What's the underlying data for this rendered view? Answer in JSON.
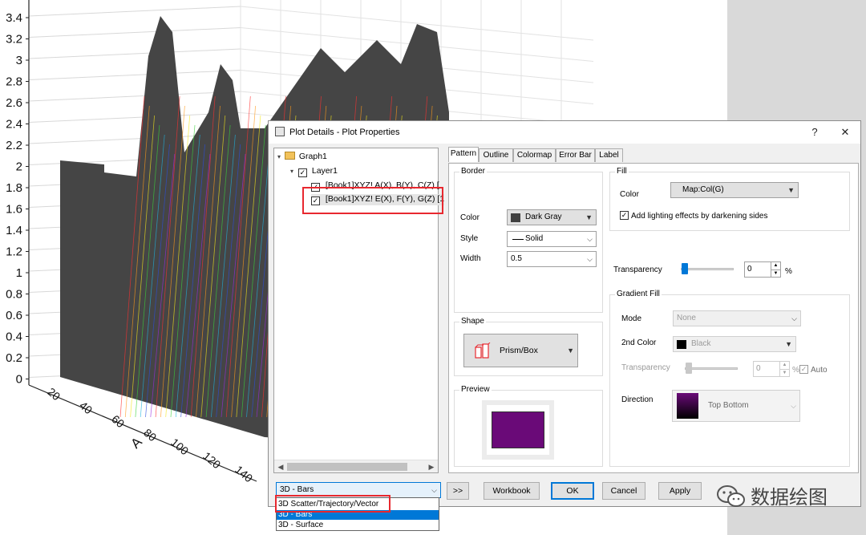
{
  "background_graph": {
    "y_ticks": [
      "3.4",
      "3.2",
      "3",
      "2.8",
      "2.6",
      "2.4",
      "2.2",
      "2",
      "1.8",
      "1.6",
      "1.4",
      "1.2",
      "1",
      "0.8",
      "0.6",
      "0.4",
      "0.2",
      "0"
    ],
    "x_ticks": [
      "20",
      "40",
      "60",
      "80",
      "100",
      "120",
      "140"
    ],
    "x_axis_label": "A"
  },
  "dialog": {
    "title": "Plot Details - Plot Properties",
    "help_button": "?",
    "close_button": "✕",
    "tree": {
      "root": "Graph1",
      "layer": "Layer1",
      "plots": [
        "[Book1]XYZ! A(X), B(Y), C(Z) [",
        "[Book1]XYZ! E(X), F(Y), G(Z) [1"
      ]
    },
    "tabs": [
      "Pattern",
      "Outline",
      "Colormap",
      "Error Bar",
      "Label"
    ],
    "border": {
      "group_label": "Border",
      "color_label": "Color",
      "color_value": "Dark Gray",
      "style_label": "Style",
      "style_value": "Solid",
      "width_label": "Width",
      "width_value": "0.5"
    },
    "fill": {
      "group_label": "Fill",
      "color_label": "Color",
      "color_value": "Map:Col(G)",
      "lighting_label": "Add lighting effects by darkening sides",
      "lighting_checked": true
    },
    "transparency": {
      "label": "Transparency",
      "value": "0",
      "unit": "%",
      "level": 0
    },
    "gradient": {
      "group_label": "Gradient Fill",
      "mode_label": "Mode",
      "mode_value": "None",
      "second_color_label": "2nd Color",
      "second_color_value": "Black",
      "transparency_label": "Transparency",
      "transparency_value": "0",
      "transparency_unit": "%",
      "auto_label": "Auto",
      "direction_label": "Direction",
      "direction_value": "Top Bottom"
    },
    "shape": {
      "group_label": "Shape",
      "value": "Prism/Box"
    },
    "preview": {
      "group_label": "Preview",
      "fill_color": "#6a0a78"
    },
    "plot_type_combo": "3D - Bars",
    "plot_type_options": [
      "3D Scatter/Trajectory/Vector",
      "3D - Bars",
      "3D - Surface"
    ],
    "buttons": {
      "expand": ">>",
      "workbook": "Workbook",
      "ok": "OK",
      "cancel": "Cancel",
      "apply": "Apply"
    }
  },
  "watermark": "数据绘图",
  "colors": {
    "highlight_red": "#e8282f",
    "selection_blue": "#0078d7",
    "preview_purple": "#6a0a78",
    "dark_gray": "#404040"
  }
}
